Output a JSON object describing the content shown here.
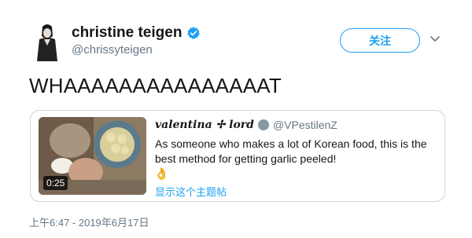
{
  "author": {
    "name": "christine teigen",
    "handle": "@chrissyteigen",
    "verified": true
  },
  "follow_button": {
    "label": "关注"
  },
  "tweet": {
    "text": "WHAAAAAAAAAAAAAAAT",
    "timestamp": "上午6:47 - 2019年6月17日"
  },
  "quoted_tweet": {
    "author_name": "valentina ✢ lord",
    "author_handle": "@VPestilenZ",
    "text": "As someone who makes a lot of Korean food, this is the best method for getting garlic peeled!",
    "emoji": "👌",
    "show_thread_label": "显示这个主题帖",
    "video_duration": "0:25"
  },
  "colors": {
    "accent": "#1da1f2",
    "text_primary": "#14171a",
    "text_secondary": "#657786",
    "border": "#ccd6dd"
  },
  "icons": [
    "avatar",
    "verified-badge-icon",
    "chevron-down-icon",
    "quote-avatar-icon",
    "video-thumbnail"
  ]
}
